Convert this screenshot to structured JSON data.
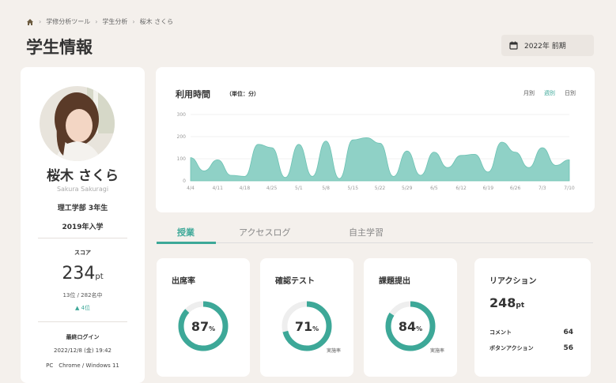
{
  "breadcrumb": {
    "items": [
      "学修分析ツール",
      "学生分析",
      "桜木 さくら"
    ]
  },
  "page_title": "学生情報",
  "term": "2022年 前期",
  "profile": {
    "name": "桜木 さくら",
    "name_en": "Sakura Sakuragi",
    "dept": "理工学部 3年生",
    "year": "2019年入学",
    "score_label": "スコア",
    "score_value": "234",
    "score_unit": "pt",
    "rank": "13位 / 282名中",
    "rank_change": "▲ 4位",
    "login_label": "最終ログイン",
    "login_date": "2022/12/8 (金) 19:42",
    "login_env": "PC　Chrome / Windows 11"
  },
  "usage": {
    "title": "利用時間",
    "unit": "（単位：分）",
    "view_options": [
      "月別",
      "週別",
      "日別"
    ],
    "active_view": "週別"
  },
  "chart_data": {
    "type": "area",
    "x": [
      "4/4",
      "4/11",
      "4/18",
      "4/25",
      "5/1",
      "5/8",
      "5/15",
      "5/22",
      "5/29",
      "6/5",
      "6/12",
      "6/19",
      "6/26",
      "7/3",
      "7/10"
    ],
    "y_ticks": [
      "300",
      "200",
      "100",
      "0"
    ],
    "ylim": [
      0,
      300
    ],
    "values": [
      105,
      45,
      95,
      25,
      20,
      165,
      150,
      15,
      165,
      20,
      180,
      10,
      185,
      195,
      170,
      20,
      135,
      25,
      130,
      60,
      115,
      120,
      40,
      175,
      130,
      60,
      150,
      70,
      95
    ],
    "color": "#8fd1c6"
  },
  "tabs": [
    "授業",
    "アクセスログ",
    "自主学習"
  ],
  "active_tab": "授業",
  "metrics": [
    {
      "title": "出席率",
      "value": "87",
      "unit": "%",
      "percent": 87,
      "sub": ""
    },
    {
      "title": "確認テスト",
      "value": "71",
      "unit": "%",
      "percent": 71,
      "sub": "実施率"
    },
    {
      "title": "課題提出",
      "value": "84",
      "unit": "%",
      "percent": 84,
      "sub": "実施率"
    }
  ],
  "reaction": {
    "title": "リアクション",
    "value": "248",
    "unit": "pt",
    "rows": [
      {
        "label": "コメント",
        "value": "64"
      },
      {
        "label": "ボタンアクション",
        "value": "56"
      }
    ]
  },
  "colors": {
    "accent": "#3da898",
    "ring_track": "#eeeeee",
    "background": "#f4f0ec"
  }
}
